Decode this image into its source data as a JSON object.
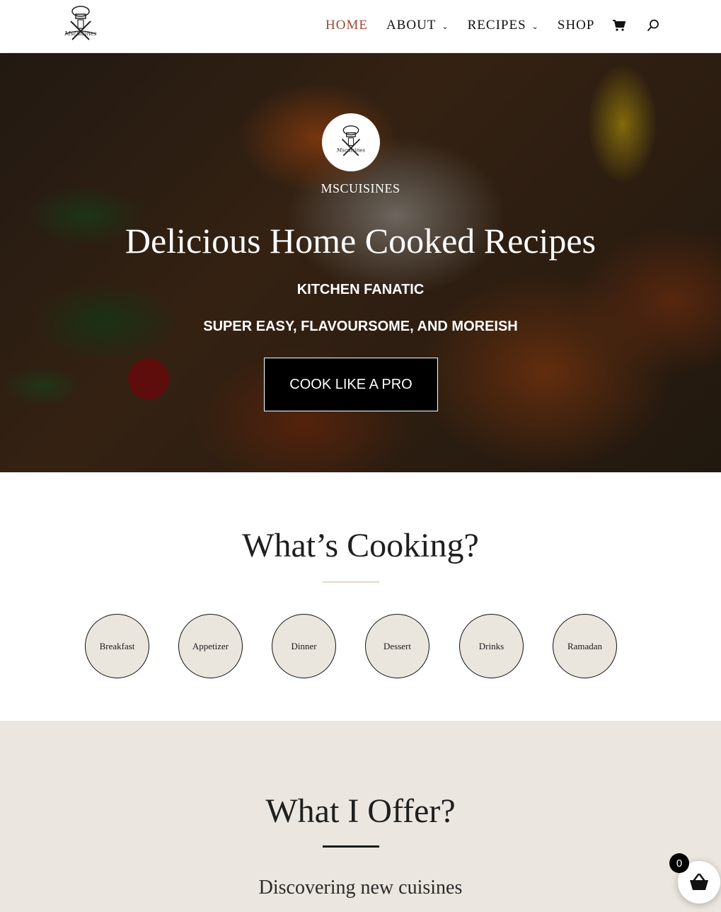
{
  "header": {
    "logo_alt": "Mscuisines",
    "nav": [
      {
        "label": "HOME",
        "has_dropdown": false,
        "active": true
      },
      {
        "label": "ABOUT",
        "has_dropdown": true,
        "active": false
      },
      {
        "label": "RECIPES",
        "has_dropdown": true,
        "active": false
      },
      {
        "label": "SHOP",
        "has_dropdown": false,
        "active": false
      }
    ],
    "active_color": "#9c4a32"
  },
  "hero": {
    "brand": "MSCUISINES",
    "title": "Delicious Home Cooked Recipes",
    "subtitle1": "KITCHEN FANATIC",
    "subtitle2": "SUPER EASY, FLAVOURSOME, AND MOREISH",
    "cta_label": "COOK LIKE A PRO"
  },
  "cooking": {
    "title": "What’s Cooking?",
    "categories": [
      "Breakfast",
      "Appetizer",
      "Dinner",
      "Dessert",
      "Drinks",
      "Ramadan"
    ]
  },
  "offer": {
    "title": "What I Offer?",
    "subtitle": "Discovering new cuisines"
  },
  "floating_cart": {
    "count": "0"
  },
  "colors": {
    "beige": "#ebe6df",
    "accent": "#9c4a32"
  }
}
